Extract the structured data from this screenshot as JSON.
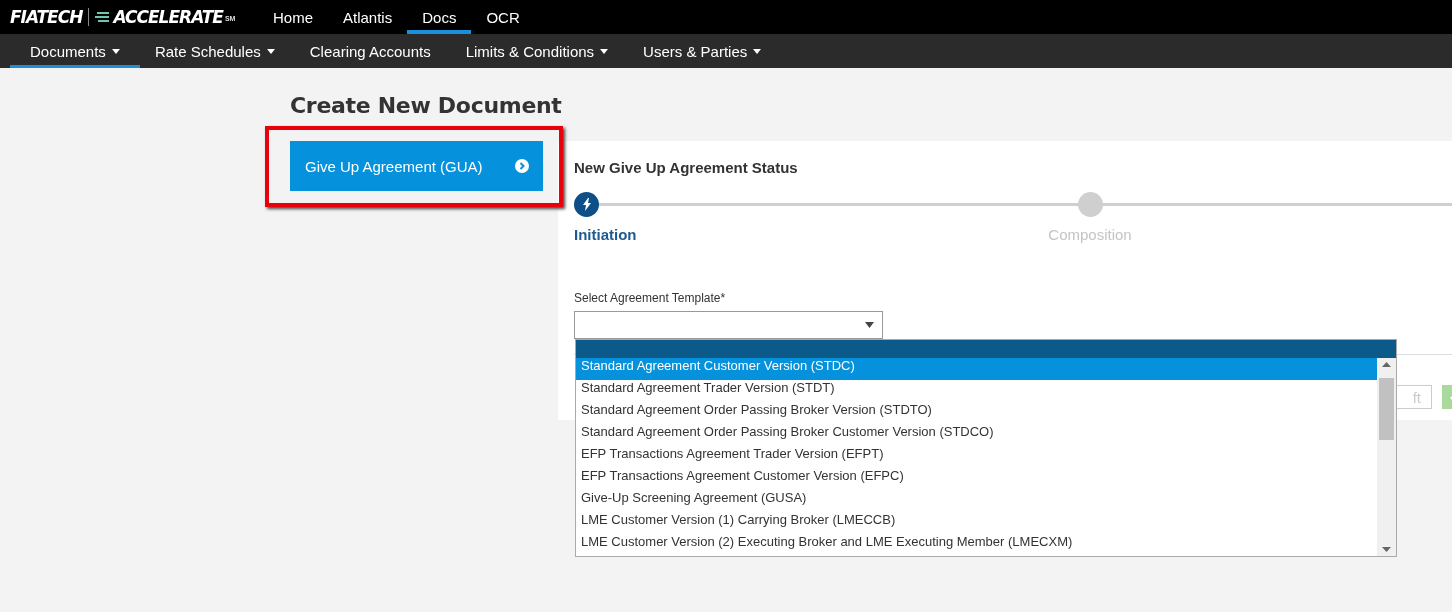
{
  "top_nav": {
    "logo": {
      "brand": "FIATECH",
      "product": "ACCELERATE",
      "mark": "SM"
    },
    "items": [
      {
        "label": "Home",
        "selected": false
      },
      {
        "label": "Atlantis",
        "selected": false
      },
      {
        "label": "Docs",
        "selected": true
      },
      {
        "label": "OCR",
        "selected": false
      }
    ]
  },
  "sub_nav": {
    "items": [
      {
        "label": "Documents",
        "selected": true,
        "has_menu": true
      },
      {
        "label": "Rate Schedules",
        "selected": false,
        "has_menu": true
      },
      {
        "label": "Clearing Accounts",
        "selected": false,
        "has_menu": false
      },
      {
        "label": "Limits & Conditions",
        "selected": false,
        "has_menu": true
      },
      {
        "label": "Users & Parties",
        "selected": false,
        "has_menu": true
      }
    ]
  },
  "page_title": "Create New Document",
  "document_types": [
    {
      "label": "Give Up Agreement (GUA)",
      "highlighted": true
    }
  ],
  "status_panel": {
    "title": "New Give Up Agreement Status",
    "steps": [
      {
        "label": "Initiation",
        "selected": true
      },
      {
        "label": "Composition",
        "selected": false
      }
    ],
    "template_field": {
      "label": "Select Agreement Template*",
      "expanded": true
    },
    "actions": [
      {
        "kind": "outline",
        "label": "ft"
      },
      {
        "kind": "confirm"
      }
    ]
  },
  "dropdown": {
    "options": [
      {
        "label": "Standard Agreement Customer Version (STDC)",
        "selected": true
      },
      {
        "label": "Standard Agreement Trader Version (STDT)",
        "selected": false
      },
      {
        "label": "Standard Agreement Order Passing Broker Version (STDTO)",
        "selected": false
      },
      {
        "label": "Standard Agreement Order Passing Broker Customer Version (STDCO)",
        "selected": false
      },
      {
        "label": "EFP Transactions Agreement Trader Version (EFPT)",
        "selected": false
      },
      {
        "label": "EFP Transactions Agreement Customer Version (EFPC)",
        "selected": false
      },
      {
        "label": "Give-Up Screening Agreement (GUSA)",
        "selected": false
      },
      {
        "label": "LME Customer Version (1) Carrying Broker (LMECCB)",
        "selected": false
      },
      {
        "label": "LME Customer Version (2) Executing Broker and LME Executing Member (LMECXM)",
        "selected": false
      }
    ]
  }
}
